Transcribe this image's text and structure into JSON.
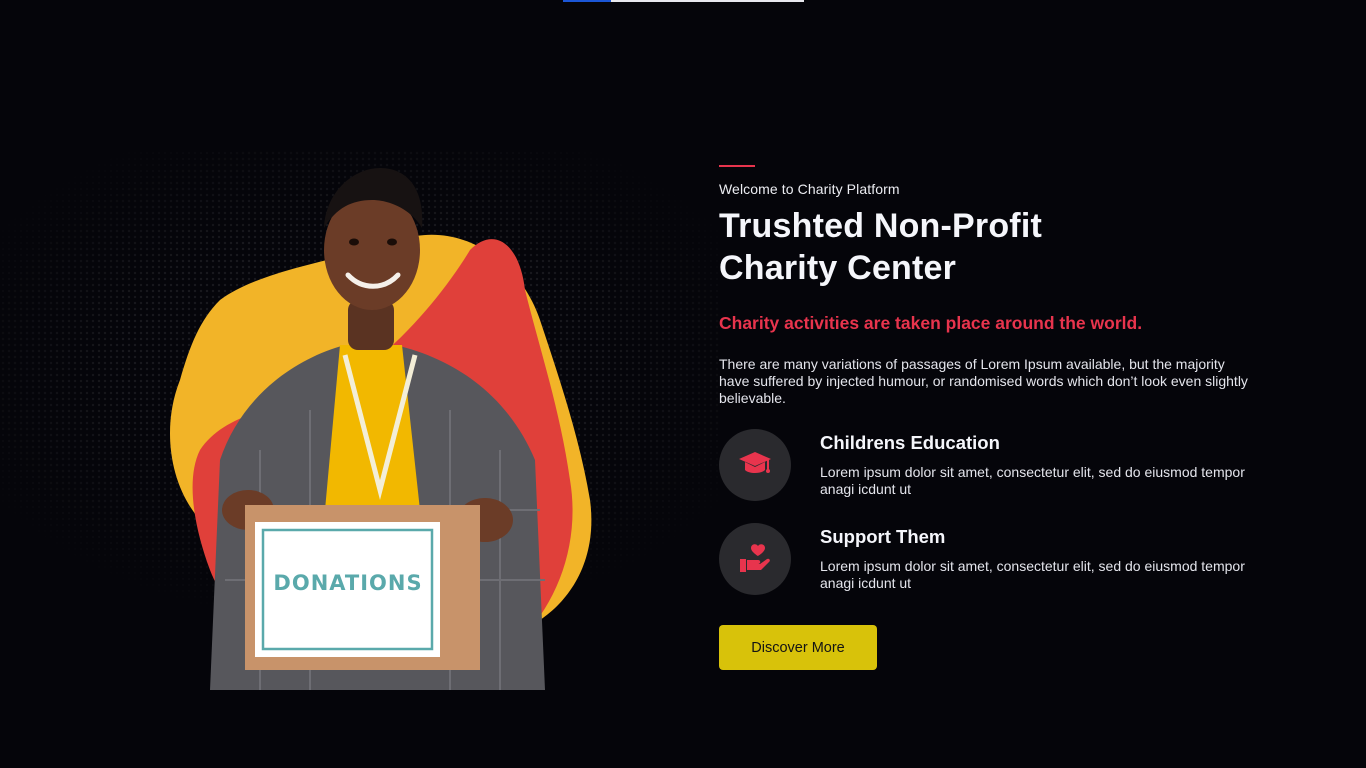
{
  "page": {
    "eyebrow": "Welcome to Charity Platform",
    "title_line1": "Trushted Non-Profit",
    "title_line2": "Charity Center",
    "highlight": "Charity activities are taken place around the world.",
    "description": "There are many variations of passages of Lorem Ipsum available, but the majority have suffered by injected humour, or randomised words which don’t look even slightly believable.",
    "features": [
      {
        "icon": "graduation-cap-icon",
        "title": "Childrens Education",
        "text": "Lorem ipsum dolor sit amet, consectetur elit, sed do eiusmod tempor anagi icdunt ut"
      },
      {
        "icon": "hand-heart-icon",
        "title": "Support Them",
        "text": "Lorem ipsum dolor sit amet, consectetur elit, sed do eiusmod tempor anagi icdunt ut"
      }
    ],
    "cta_label": "Discover More",
    "box_label": "DONATIONS"
  },
  "progress": {
    "value": 0.2
  },
  "colors": {
    "background": "#05050a",
    "accent_red": "#e8344d",
    "accent_yellow": "#d8c20a",
    "icon_circle": "#2a2a2e"
  }
}
